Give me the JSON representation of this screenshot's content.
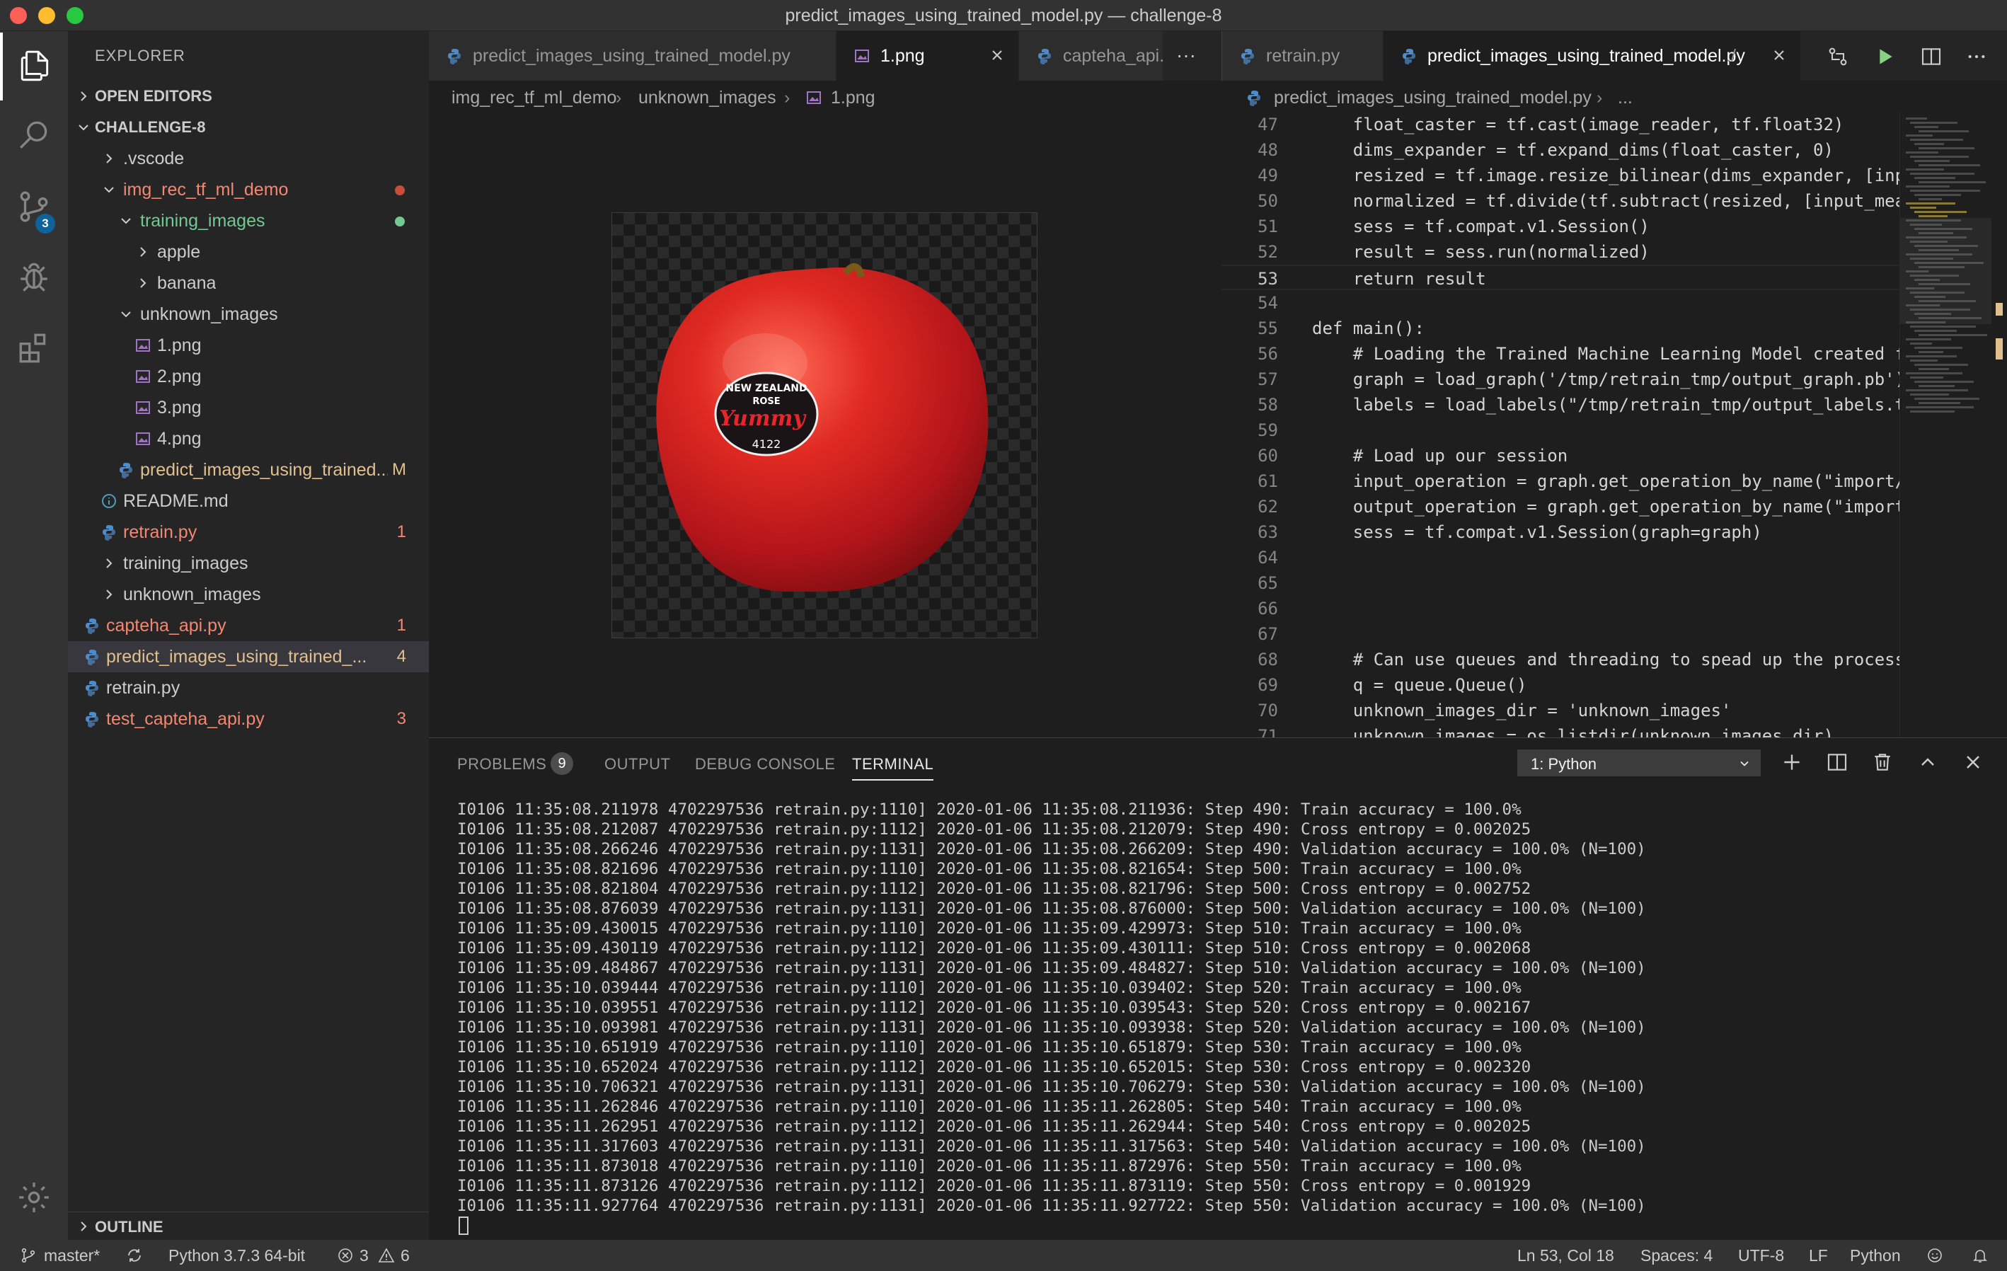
{
  "window": {
    "title": "predict_images_using_trained_model.py — challenge-8"
  },
  "activity_bar": {
    "scm_badge": "3"
  },
  "explorer": {
    "title": "EXPLORER",
    "open_editors": "OPEN EDITORS",
    "root": "CHALLENGE-8",
    "outline": "OUTLINE",
    "tree": [
      {
        "label": ".vscode",
        "type": "folder",
        "expanded": false,
        "color": "default",
        "mark": ""
      },
      {
        "label": "img_rec_tf_ml_demo",
        "type": "folder",
        "expanded": true,
        "color": "red",
        "mark": "dot-red"
      },
      {
        "label": "training_images",
        "type": "folder",
        "expanded": true,
        "color": "green",
        "mark": "dot-green"
      },
      {
        "label": "apple",
        "type": "folder",
        "expanded": false,
        "color": "default",
        "mark": ""
      },
      {
        "label": "banana",
        "type": "folder",
        "expanded": false,
        "color": "default",
        "mark": ""
      },
      {
        "label": "unknown_images",
        "type": "folder",
        "expanded": true,
        "color": "default",
        "mark": ""
      },
      {
        "label": "1.png",
        "type": "image",
        "color": "default",
        "mark": ""
      },
      {
        "label": "2.png",
        "type": "image",
        "color": "default",
        "mark": ""
      },
      {
        "label": "3.png",
        "type": "image",
        "color": "default",
        "mark": ""
      },
      {
        "label": "4.png",
        "type": "image",
        "color": "default",
        "mark": ""
      },
      {
        "label": "predict_images_using_trained...",
        "type": "python",
        "color": "yellow",
        "mark": "M"
      },
      {
        "label": "README.md",
        "type": "info",
        "color": "default",
        "mark": ""
      },
      {
        "label": "retrain.py",
        "type": "python",
        "color": "red",
        "mark": "1"
      },
      {
        "label": "training_images",
        "type": "folder",
        "expanded": false,
        "color": "default",
        "mark": ""
      },
      {
        "label": "unknown_images",
        "type": "folder",
        "expanded": false,
        "color": "default",
        "mark": ""
      },
      {
        "label": "capteha_api.py",
        "type": "python",
        "color": "red",
        "mark": "1"
      },
      {
        "label": "predict_images_using_trained_...",
        "type": "python",
        "color": "yellow",
        "mark": "4"
      },
      {
        "label": "retrain.py",
        "type": "python",
        "color": "default",
        "mark": ""
      },
      {
        "label": "test_capteha_api.py",
        "type": "python",
        "color": "red",
        "mark": "3"
      }
    ]
  },
  "left_editor": {
    "tabs": [
      {
        "label": "predict_images_using_trained_model.py",
        "icon": "python-icon",
        "active": false
      },
      {
        "label": "1.png",
        "icon": "image-icon",
        "active": true
      },
      {
        "label": "capteha_api.py",
        "icon": "python-icon",
        "active": false
      }
    ],
    "more": "···",
    "breadcrumb": [
      "img_rec_tf_ml_demo",
      "unknown_images",
      "1.png"
    ],
    "image_sticker": {
      "line1": "NEW ZEALAND",
      "line2": "ROSE",
      "brand": "Yummy",
      "code": "4122"
    }
  },
  "right_editor": {
    "tabs": [
      {
        "label": "retrain.py",
        "active": false
      },
      {
        "label": "predict_images_using_trained_model.py",
        "suffix": "./",
        "active": true
      }
    ],
    "breadcrumb": [
      "predict_images_using_trained_model.py",
      "..."
    ],
    "code": [
      {
        "n": "47",
        "t": "    float_caster = tf.cast(image_reader, tf.float32)"
      },
      {
        "n": "48",
        "t": "    dims_expander = tf.expand_dims(float_caster, 0)"
      },
      {
        "n": "49",
        "t": "    resized = tf.image.resize_bilinear(dims_expander, [input_height, input_width])"
      },
      {
        "n": "50",
        "t": "    normalized = tf.divide(tf.subtract(resized, [input_mean]), [input_std])"
      },
      {
        "n": "51",
        "t": "    sess = tf.compat.v1.Session()"
      },
      {
        "n": "52",
        "t": "    result = sess.run(normalized)"
      },
      {
        "n": "53",
        "t": "    return result"
      },
      {
        "n": "54",
        "t": ""
      },
      {
        "n": "55",
        "t": "def main():"
      },
      {
        "n": "56",
        "t": "    # Loading the Trained Machine Learning Model created from running retrain.py"
      },
      {
        "n": "57",
        "t": "    graph = load_graph('/tmp/retrain_tmp/output_graph.pb')"
      },
      {
        "n": "58",
        "t": "    labels = load_labels(\"/tmp/retrain_tmp/output_labels.txt\")"
      },
      {
        "n": "59",
        "t": ""
      },
      {
        "n": "60",
        "t": "    # Load up our session"
      },
      {
        "n": "61",
        "t": "    input_operation = graph.get_operation_by_name(\"import/Placeholder\")"
      },
      {
        "n": "62",
        "t": "    output_operation = graph.get_operation_by_name(\"import/final_result\")"
      },
      {
        "n": "63",
        "t": "    sess = tf.compat.v1.Session(graph=graph)"
      },
      {
        "n": "64",
        "t": ""
      },
      {
        "n": "65",
        "t": ""
      },
      {
        "n": "66",
        "t": ""
      },
      {
        "n": "67",
        "t": ""
      },
      {
        "n": "68",
        "t": "    # Can use queues and threading to spead up the processing"
      },
      {
        "n": "69",
        "t": "    q = queue.Queue()"
      },
      {
        "n": "70",
        "t": "    unknown_images_dir = 'unknown_images'"
      },
      {
        "n": "71",
        "t": "    unknown_images = os.listdir(unknown_images_dir)"
      }
    ]
  },
  "panel": {
    "tabs": {
      "problems": "PROBLEMS",
      "problems_count": "9",
      "output": "OUTPUT",
      "debug": "DEBUG CONSOLE",
      "terminal": "TERMINAL"
    },
    "terminal_select": "1: Python",
    "terminal_lines": [
      "I0106 11:35:08.211978 4702297536 retrain.py:1110] 2020-01-06 11:35:08.211936: Step 490: Train accuracy = 100.0%",
      "I0106 11:35:08.212087 4702297536 retrain.py:1112] 2020-01-06 11:35:08.212079: Step 490: Cross entropy = 0.002025",
      "I0106 11:35:08.266246 4702297536 retrain.py:1131] 2020-01-06 11:35:08.266209: Step 490: Validation accuracy = 100.0% (N=100)",
      "I0106 11:35:08.821696 4702297536 retrain.py:1110] 2020-01-06 11:35:08.821654: Step 500: Train accuracy = 100.0%",
      "I0106 11:35:08.821804 4702297536 retrain.py:1112] 2020-01-06 11:35:08.821796: Step 500: Cross entropy = 0.002752",
      "I0106 11:35:08.876039 4702297536 retrain.py:1131] 2020-01-06 11:35:08.876000: Step 500: Validation accuracy = 100.0% (N=100)",
      "I0106 11:35:09.430015 4702297536 retrain.py:1110] 2020-01-06 11:35:09.429973: Step 510: Train accuracy = 100.0%",
      "I0106 11:35:09.430119 4702297536 retrain.py:1112] 2020-01-06 11:35:09.430111: Step 510: Cross entropy = 0.002068",
      "I0106 11:35:09.484867 4702297536 retrain.py:1131] 2020-01-06 11:35:09.484827: Step 510: Validation accuracy = 100.0% (N=100)",
      "I0106 11:35:10.039444 4702297536 retrain.py:1110] 2020-01-06 11:35:10.039402: Step 520: Train accuracy = 100.0%",
      "I0106 11:35:10.039551 4702297536 retrain.py:1112] 2020-01-06 11:35:10.039543: Step 520: Cross entropy = 0.002167",
      "I0106 11:35:10.093981 4702297536 retrain.py:1131] 2020-01-06 11:35:10.093938: Step 520: Validation accuracy = 100.0% (N=100)",
      "I0106 11:35:10.651919 4702297536 retrain.py:1110] 2020-01-06 11:35:10.651879: Step 530: Train accuracy = 100.0%",
      "I0106 11:35:10.652024 4702297536 retrain.py:1112] 2020-01-06 11:35:10.652015: Step 530: Cross entropy = 0.002320",
      "I0106 11:35:10.706321 4702297536 retrain.py:1131] 2020-01-06 11:35:10.706279: Step 530: Validation accuracy = 100.0% (N=100)",
      "I0106 11:35:11.262846 4702297536 retrain.py:1110] 2020-01-06 11:35:11.262805: Step 540: Train accuracy = 100.0%",
      "I0106 11:35:11.262951 4702297536 retrain.py:1112] 2020-01-06 11:35:11.262944: Step 540: Cross entropy = 0.002025",
      "I0106 11:35:11.317603 4702297536 retrain.py:1131] 2020-01-06 11:35:11.317563: Step 540: Validation accuracy = 100.0% (N=100)",
      "I0106 11:35:11.873018 4702297536 retrain.py:1110] 2020-01-06 11:35:11.872976: Step 550: Train accuracy = 100.0%",
      "I0106 11:35:11.873126 4702297536 retrain.py:1112] 2020-01-06 11:35:11.873119: Step 550: Cross entropy = 0.001929",
      "I0106 11:35:11.927764 4702297536 retrain.py:1131] 2020-01-06 11:35:11.927722: Step 550: Validation accuracy = 100.0% (N=100)"
    ]
  },
  "status": {
    "branch": "master*",
    "python": "Python 3.7.3 64-bit",
    "errors": "3",
    "warnings": "6",
    "position": "Ln 53, Col 18",
    "spaces": "Spaces: 4",
    "encoding": "UTF-8",
    "eol": "LF",
    "language": "Python"
  },
  "colors": {
    "accent_blue": "#0e639c",
    "git_red": "#f48771",
    "git_green": "#73c991",
    "git_yellow": "#e2c08d"
  }
}
